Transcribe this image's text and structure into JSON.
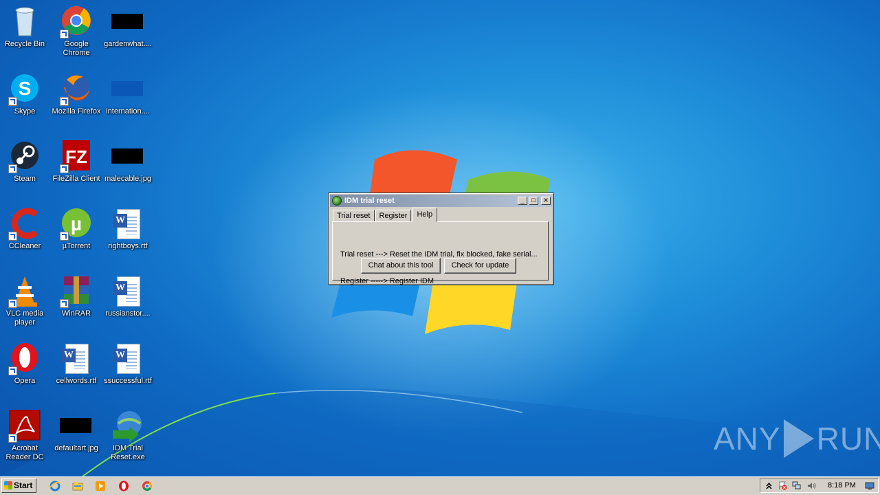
{
  "desktop": {
    "icons": [
      {
        "label": "Recycle Bin",
        "icon": "recycle-bin-icon"
      },
      {
        "label": "Google Chrome",
        "icon": "chrome-icon"
      },
      {
        "label": "gardenwhat....",
        "icon": "image-file-icon"
      },
      {
        "label": "Skype",
        "icon": "skype-icon"
      },
      {
        "label": "Mozilla Firefox",
        "icon": "firefox-icon"
      },
      {
        "label": "internation....",
        "icon": "image-file-icon"
      },
      {
        "label": "Steam",
        "icon": "steam-icon"
      },
      {
        "label": "FileZilla Client",
        "icon": "filezilla-icon"
      },
      {
        "label": "malecable.jpg",
        "icon": "image-file-icon"
      },
      {
        "label": "CCleaner",
        "icon": "ccleaner-icon"
      },
      {
        "label": "µTorrent",
        "icon": "utorrent-icon"
      },
      {
        "label": "rightboys.rtf",
        "icon": "word-document-icon"
      },
      {
        "label": "VLC media player",
        "icon": "vlc-icon"
      },
      {
        "label": "WinRAR",
        "icon": "winrar-icon"
      },
      {
        "label": "russianstor....",
        "icon": "word-document-icon"
      },
      {
        "label": "Opera",
        "icon": "opera-icon"
      },
      {
        "label": "cellwords.rtf",
        "icon": "word-document-icon"
      },
      {
        "label": "ssuccessful.rtf",
        "icon": "word-document-icon"
      },
      {
        "label": "Acrobat Reader DC",
        "icon": "acrobat-icon"
      },
      {
        "label": "defaultart.jpg",
        "icon": "image-file-icon"
      },
      {
        "label": "IDM Trial Reset.exe",
        "icon": "idm-icon"
      }
    ]
  },
  "dialog": {
    "title": "IDM trial reset",
    "tabs": [
      {
        "label": "Trial reset",
        "active": false
      },
      {
        "label": "Register",
        "active": false
      },
      {
        "label": "Help",
        "active": true
      }
    ],
    "help_lines": [
      "Trial reset ---> Reset the IDM trial, fix blocked, fake serial...",
      "Register -----> Register IDM"
    ],
    "buttons": {
      "chat": "Chat about this tool",
      "update": "Check for update"
    },
    "controls": {
      "minimize": "_",
      "maximize": "□",
      "close": "×"
    }
  },
  "watermark": {
    "left": "ANY",
    "right": "RUN"
  },
  "taskbar": {
    "start_label": "Start",
    "quicklaunch": [
      "internet-explorer-icon",
      "explorer-icon",
      "media-player-icon",
      "opera-icon",
      "chrome-icon"
    ],
    "tray_icons": [
      "show-hidden-icon",
      "flag-alert-icon",
      "network-icon",
      "volume-icon"
    ],
    "clock": "8:18 PM"
  }
}
